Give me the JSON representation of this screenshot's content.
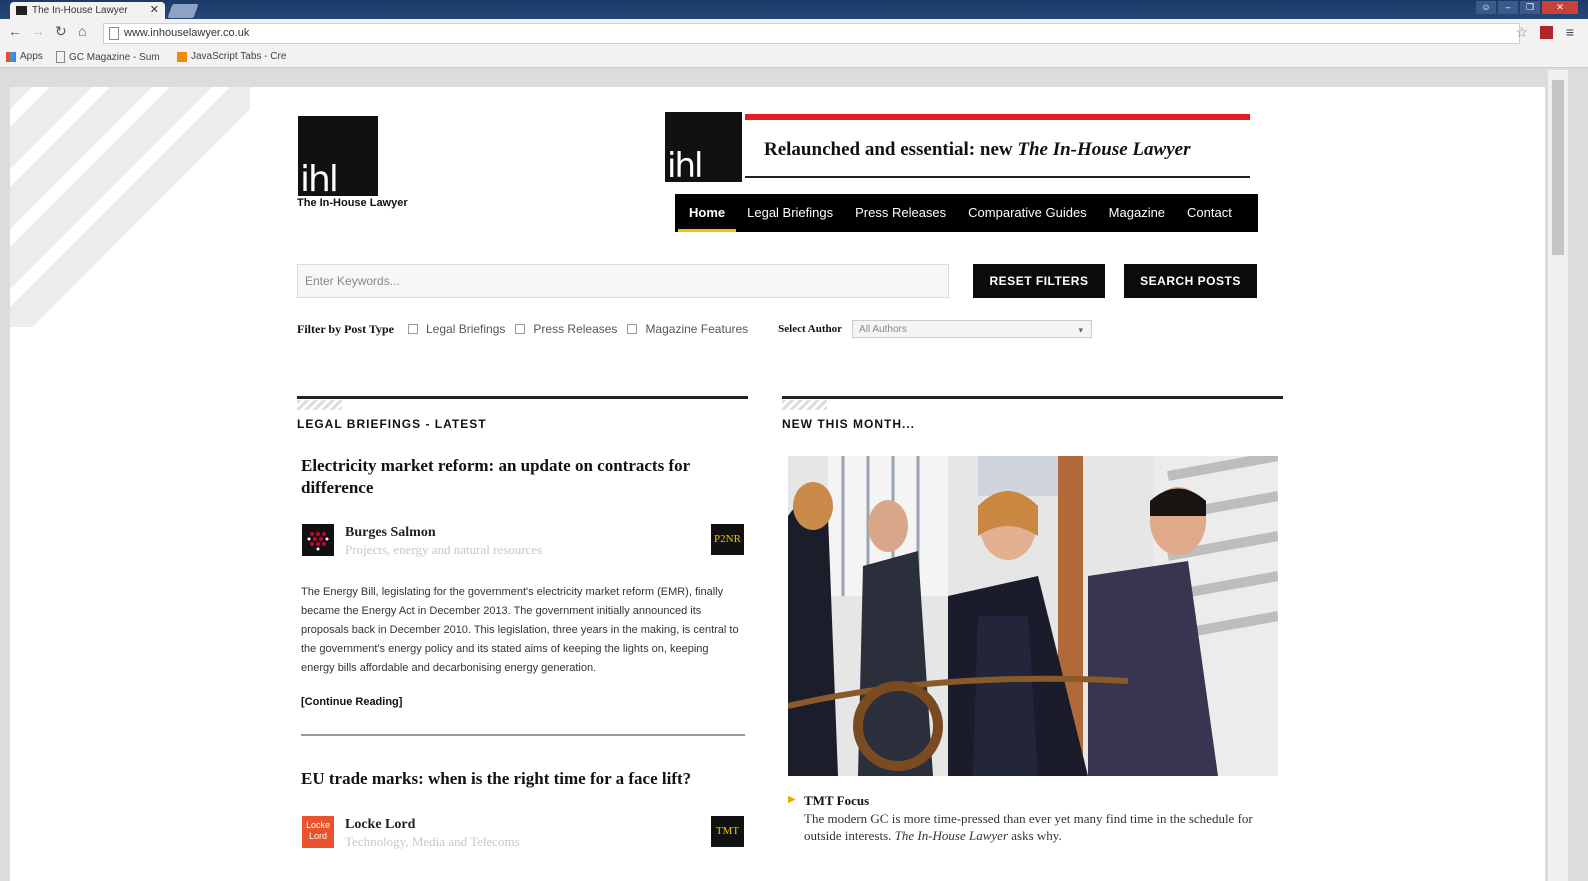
{
  "browser": {
    "tab_title": "The In-House Lawyer",
    "url": "www.inhouselawyer.co.uk",
    "bookmarks": [
      "Apps",
      "GC Magazine - Sum",
      "JavaScript Tabs - Cre"
    ]
  },
  "site": {
    "logo_text": "ihl",
    "logo_caption": "The In-House Lawyer",
    "banner_text_plain": "Relaunched and essential: new ",
    "banner_text_italic": "The In-House Lawyer",
    "nav": [
      "Home",
      "Legal Briefings",
      "Press Releases",
      "Comparative Guides",
      "Magazine",
      "Contact"
    ],
    "nav_active": "Home"
  },
  "search": {
    "placeholder": "Enter Keywords...",
    "reset_label": "RESET FILTERS",
    "search_label": "SEARCH POSTS"
  },
  "filters": {
    "label": "Filter by Post Type",
    "options": [
      "Legal Briefings",
      "Press Releases",
      "Magazine Features"
    ],
    "author_label": "Select Author",
    "author_value": "All Authors"
  },
  "left_column": {
    "heading": "LEGAL BRIEFINGS - LATEST",
    "articles": [
      {
        "title": "Electricity market reform: an update on contracts for difference",
        "firm": "Burges Salmon",
        "sector": "Projects, energy and natural resources",
        "tag": "P2NR",
        "excerpt": "The Energy Bill, legislating for the government's electricity market reform (EMR), finally became the Energy Act in December 2013. The government initially announced its proposals back in December 2010. This legislation, three years in the making, is central to the government's energy policy and its stated aims of keeping the lights on, keeping energy bills affordable and decarbonising energy generation.",
        "more": "[Continue Reading]"
      },
      {
        "title": "EU trade marks: when is the right time for a face lift?",
        "firm": "Locke Lord",
        "sector": "Technology, Media and Telecoms",
        "tag": "TMT",
        "firm_logo_text": "Locke Lord"
      }
    ]
  },
  "right_column": {
    "heading": "NEW THIS MONTH...",
    "feature_title": "TMT Focus",
    "feature_desc_plain": "The modern GC is more time-pressed than ever yet many find time in the schedule for outside interests. ",
    "feature_desc_italic": "The In-House Lawyer",
    "feature_desc_end": " asks why."
  },
  "colors": {
    "accent_red": "#e41c23",
    "nav_underline": "#f2c500",
    "firm_logo_orange": "#e8532b"
  }
}
